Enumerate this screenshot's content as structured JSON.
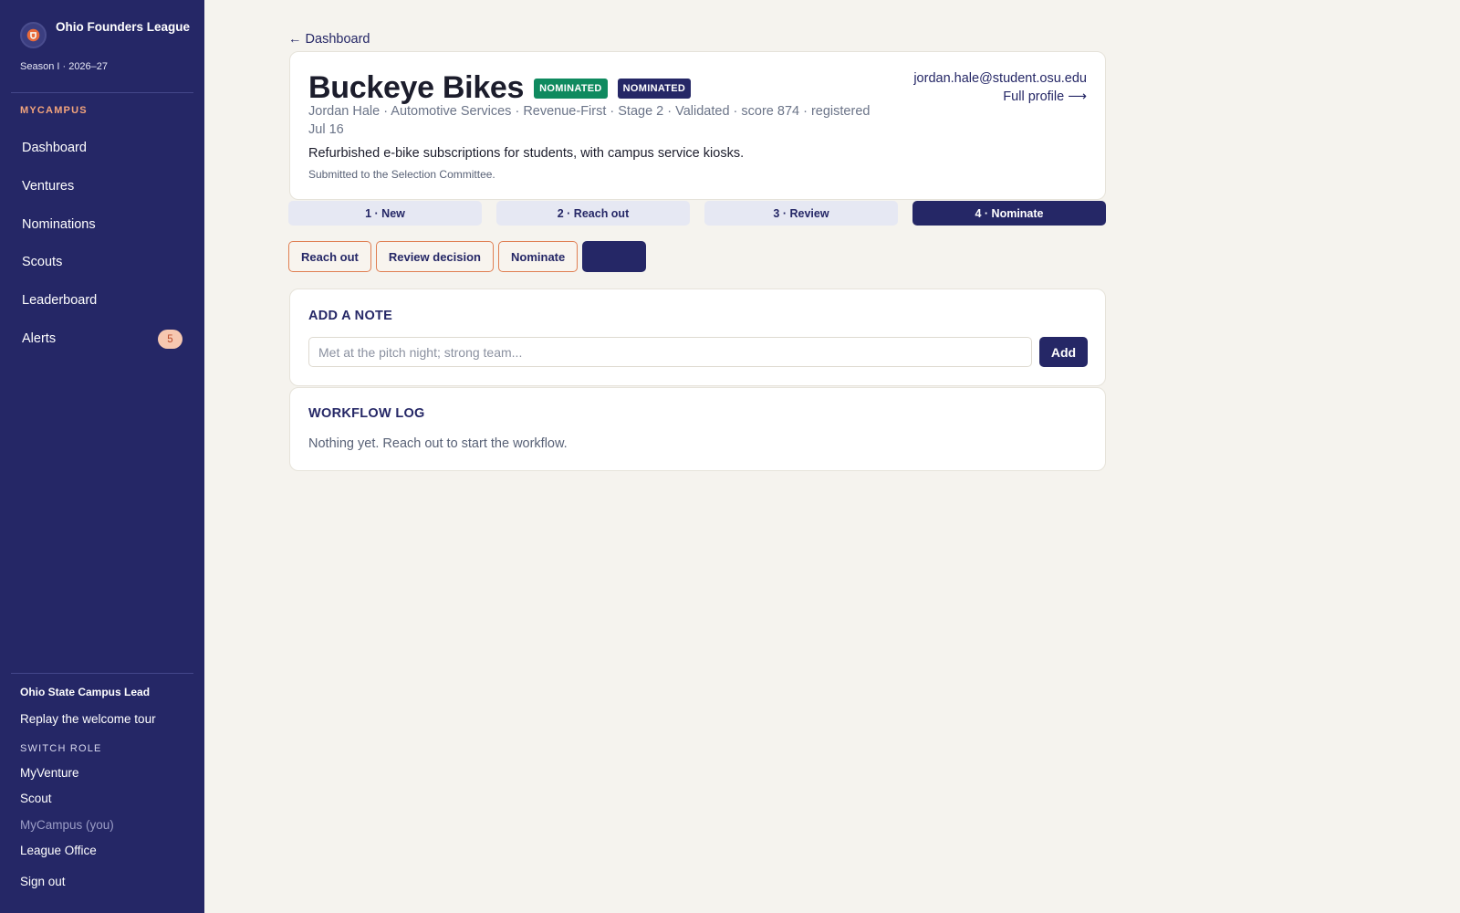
{
  "sidebar": {
    "brand_name": "Ohio Founders League",
    "season": "Season I · 2026–27",
    "section_label": "MYCAMPUS",
    "nav": [
      {
        "label": "Dashboard"
      },
      {
        "label": "Ventures"
      },
      {
        "label": "Nominations"
      },
      {
        "label": "Scouts"
      },
      {
        "label": "Leaderboard"
      },
      {
        "label": "Alerts",
        "badge": "5"
      }
    ],
    "footer": {
      "role_title": "Ohio State Campus Lead",
      "tour_link": "Replay the welcome tour",
      "switch_label": "SWITCH ROLE",
      "roles": [
        "MyVenture",
        "Scout",
        "MyCampus (you)",
        "League Office"
      ],
      "sign_out": "Sign out"
    }
  },
  "main": {
    "back_link": "← Dashboard",
    "venture": {
      "name": "Buckeye Bikes",
      "badges": [
        "NOMINATED",
        "NOMINATED"
      ],
      "meta": "Jordan Hale · Automotive Services · Revenue-First · Stage 2 · Validated · score 874 · registered Jul 16",
      "description": "Refurbished e-bike subscriptions for students, with campus service kiosks.",
      "submitted": "Submitted to the Selection Committee.",
      "email": "jordan.hale@student.osu.edu",
      "full_profile": "Full profile ⟶"
    },
    "steps": [
      "1 · New",
      "2 · Reach out",
      "3 · Review",
      "4 · Nominate"
    ],
    "active_step_index": 3,
    "actions": [
      "Reach out",
      "Review decision",
      "Nominate",
      ""
    ],
    "note": {
      "title": "ADD A NOTE",
      "placeholder": "Met at the pitch night; strong team...",
      "add_label": "Add"
    },
    "log": {
      "title": "WORKFLOW LOG",
      "empty_text": "Nothing yet. Reach out to start the workflow."
    }
  },
  "colors": {
    "sidebar_bg": "#252766",
    "accent_orange": "#e07f52",
    "badge_green": "#0f8a5f",
    "page_bg": "#f5f3ee"
  }
}
